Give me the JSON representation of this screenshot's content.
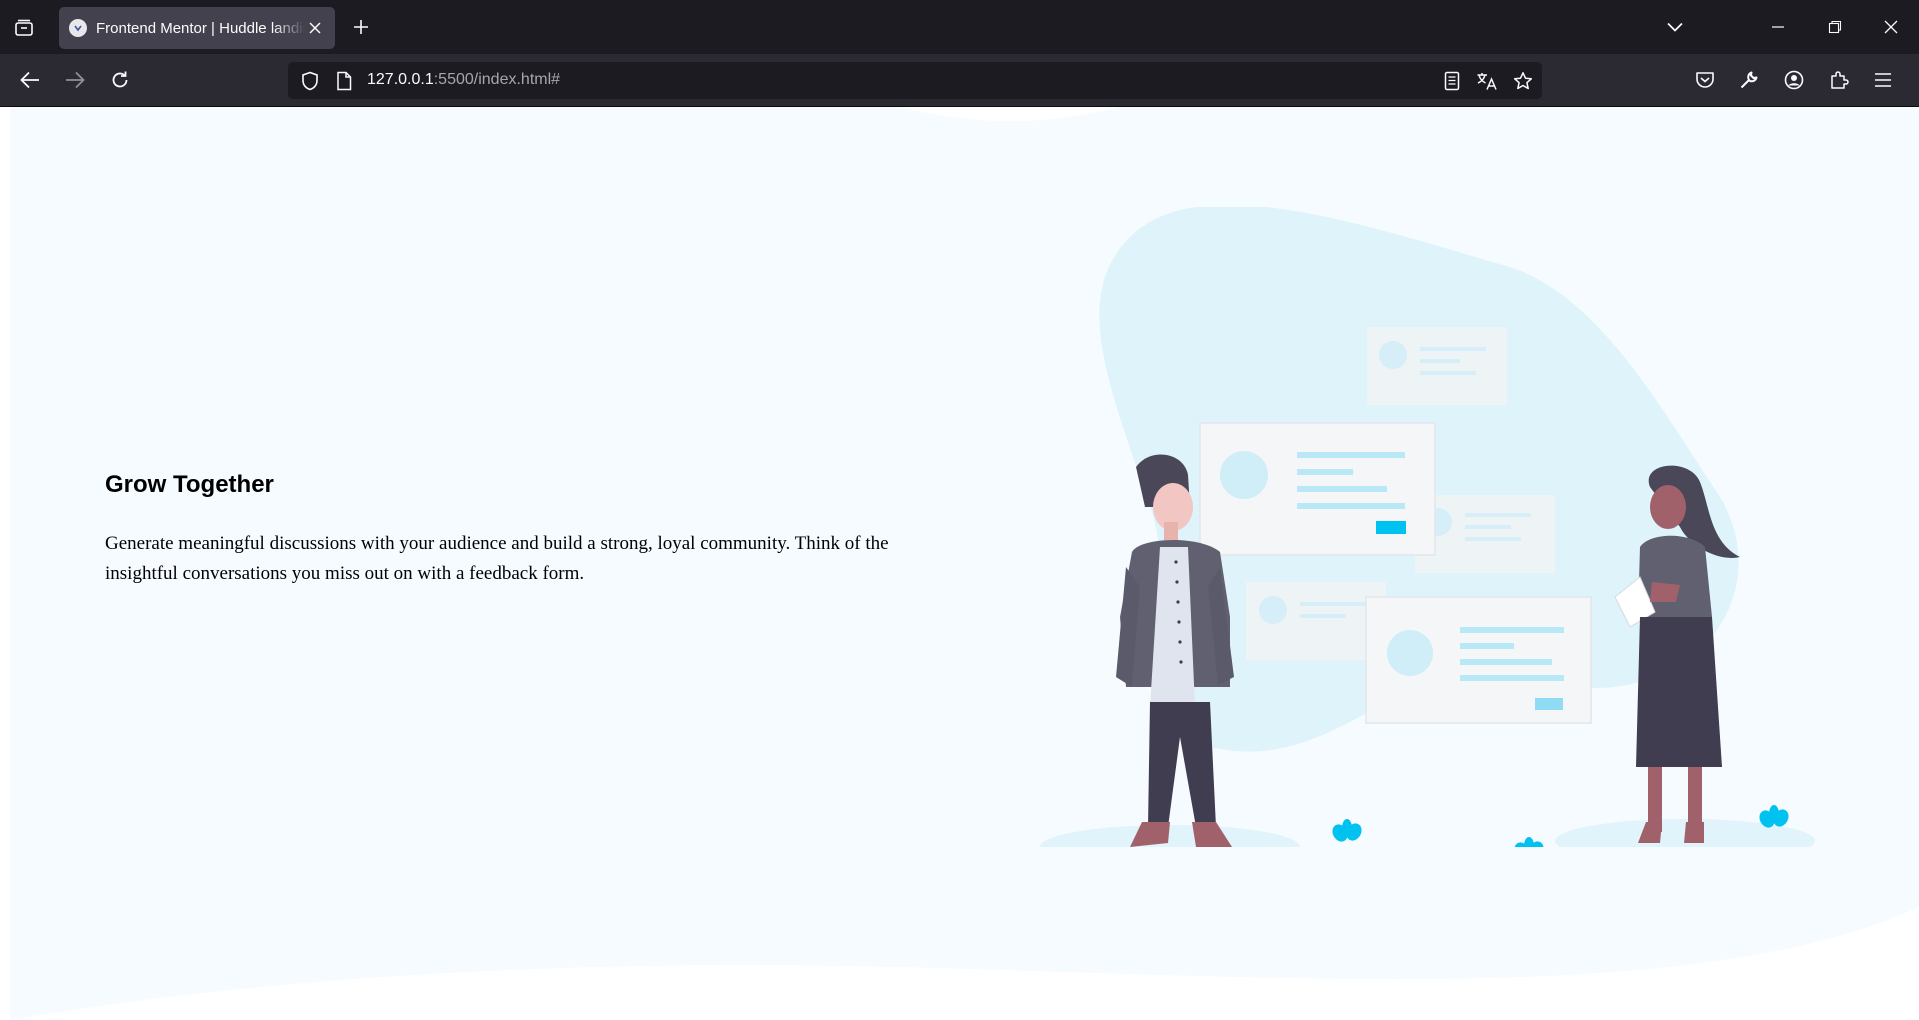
{
  "browser": {
    "tab_title": "Frontend Mentor | Huddle landing page",
    "url_host": "127.0.0.1",
    "url_rest": ":5500/index.html#"
  },
  "icons": {
    "tab_overview": "tab-overview-icon",
    "favicon": "frontend-mentor-favicon",
    "close_tab": "close-icon",
    "new_tab": "plus-icon",
    "list_tabs": "chevron-down-icon",
    "minimize": "minimize-icon",
    "restore": "restore-icon",
    "close_window": "close-icon",
    "back": "arrow-left-icon",
    "forward": "arrow-right-icon",
    "reload": "reload-icon",
    "tracking_protection": "shield-icon",
    "page_info": "document-icon",
    "reader_view": "reader-view-icon",
    "translate": "translate-icon",
    "bookmark": "star-icon",
    "pocket": "pocket-icon",
    "devtools": "wrench-icon",
    "account": "account-icon",
    "extensions": "puzzle-icon",
    "menu": "hamburger-menu-icon"
  },
  "page": {
    "heading": "Grow Together",
    "body": "Generate meaningful discussions with your audience and build a strong, loyal community. Think of the insightful conversations you miss out on with a feedback form."
  },
  "colors": {
    "page_bg": "#f5fbff",
    "accent": "#00c2f0",
    "blob": "#dff3fb"
  }
}
